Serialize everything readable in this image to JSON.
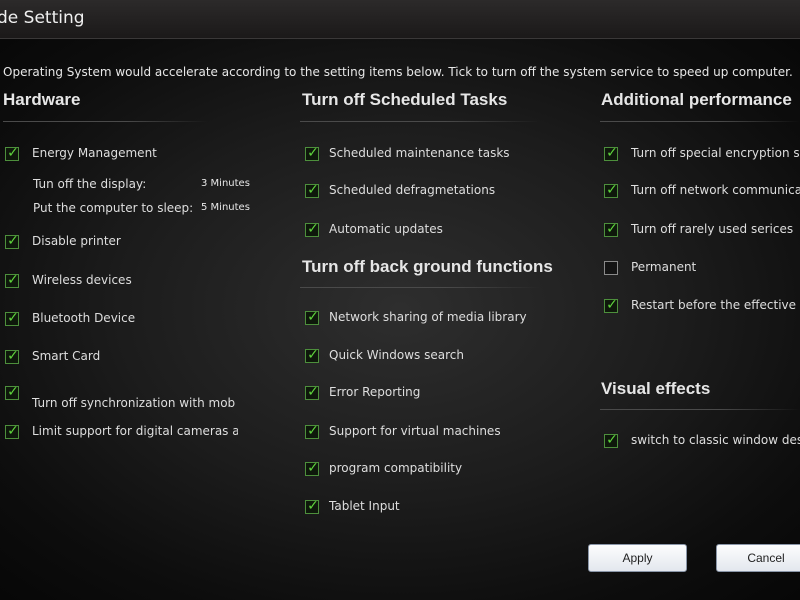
{
  "window": {
    "title": "de Setting"
  },
  "description": "Operating System would accelerate according to the setting items below. Tick to turn off the system service to speed up computer.",
  "hardware": {
    "title": "Hardware",
    "energy": {
      "label": "Energy Management",
      "checked": true
    },
    "display": {
      "label": "Tun off the display:",
      "value": "3 Minutes"
    },
    "sleep": {
      "label": "Put the computer to sleep:",
      "value": "5 Minutes"
    },
    "items": [
      {
        "label": "Disable printer",
        "checked": true
      },
      {
        "label": "Wireless devices",
        "checked": true
      },
      {
        "label": "Bluetooth Device",
        "checked": true
      },
      {
        "label": "Smart Card",
        "checked": true
      },
      {
        "label": "Turn off synchronization with mob",
        "checked": true
      },
      {
        "label": "Limit support for digital cameras ar",
        "checked": true
      }
    ]
  },
  "scheduled": {
    "title": "Turn off Scheduled Tasks",
    "items": [
      {
        "label": "Scheduled maintenance tasks",
        "checked": true
      },
      {
        "label": "Scheduled defragmetations",
        "checked": true
      },
      {
        "label": "Automatic updates",
        "checked": true
      }
    ]
  },
  "background": {
    "title": "Turn off back ground functions",
    "items": [
      {
        "label": "Network sharing of media library",
        "checked": true
      },
      {
        "label": "Quick Windows search",
        "checked": true
      },
      {
        "label": "Error Reporting",
        "checked": true
      },
      {
        "label": "Support for virtual machines",
        "checked": true
      },
      {
        "label": "program compatibility",
        "checked": true
      },
      {
        "label": "Tablet Input",
        "checked": true
      }
    ]
  },
  "additional": {
    "title": "Additional performance",
    "items": [
      {
        "label": "Turn off special encryption se",
        "checked": true
      },
      {
        "label": "Turn off network communicat",
        "checked": true
      },
      {
        "label": "Turn off rarely used serices",
        "checked": true
      },
      {
        "label": "Permanent",
        "checked": false
      },
      {
        "label": "Restart before the effective",
        "checked": true
      }
    ]
  },
  "visual": {
    "title": "Visual effects",
    "items": [
      {
        "label": "switch to classic window desi",
        "checked": true
      }
    ]
  },
  "buttons": {
    "apply": "Apply",
    "cancel": "Cancel"
  },
  "colors": {
    "check": "#5fd43c",
    "background": "#0a0a0a"
  }
}
